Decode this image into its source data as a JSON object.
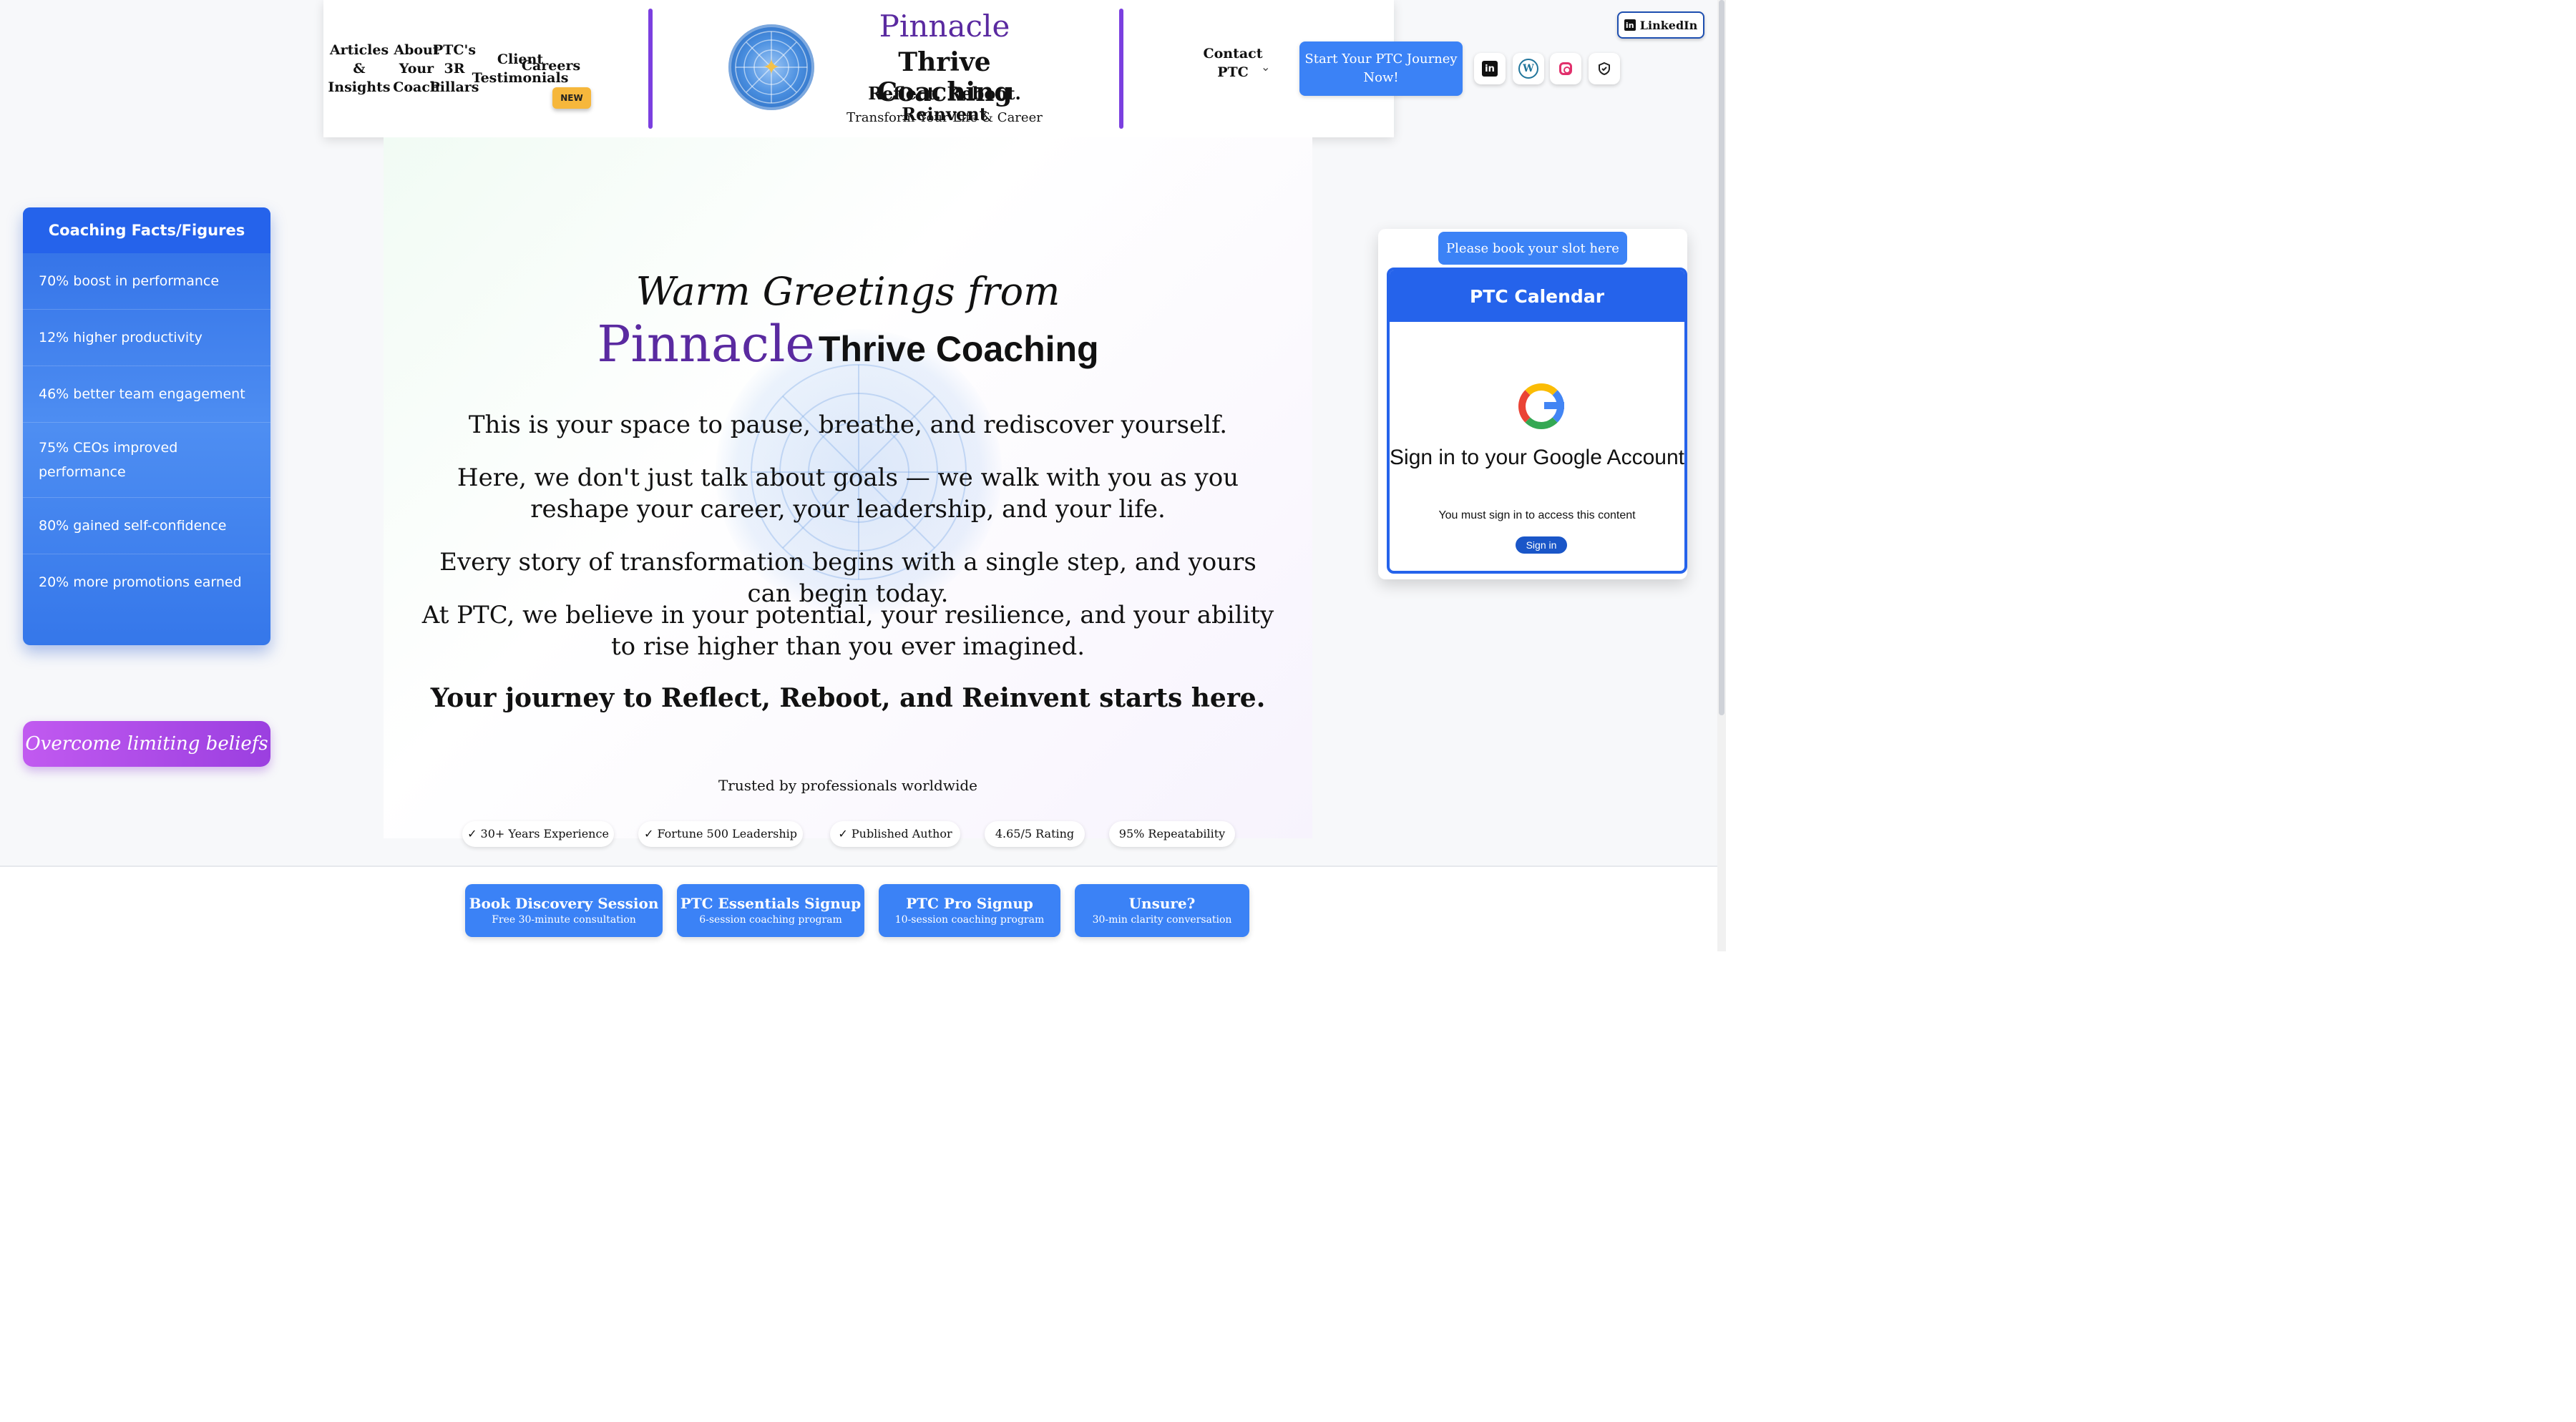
{
  "nav": {
    "about": "About Your Coach",
    "testimonials": "Client Testimonials",
    "articles": "Articles & Insights",
    "pillars": "PTC's 3R Pillars",
    "careers": "Careers",
    "new_badge": "NEW",
    "contact": "Contact PTC",
    "cta": "Start Your PTC Journey Now!"
  },
  "brand": {
    "name": "Pinnacle",
    "title": "Thrive Coaching",
    "tagline": "Reflect. Reboot. Reinvent",
    "subtitle": "Transform Your Life & Career"
  },
  "social": {
    "linkedin_badge": "LinkedIn",
    "icons": [
      "linkedin-icon",
      "wordpress-icon",
      "instagram-icon",
      "shield-icon"
    ]
  },
  "facts": {
    "title": "Coaching Facts/Figures",
    "items": [
      "70% boost in performance",
      "12% higher productivity",
      "46% better team engagement",
      "75% CEOs improved performance",
      "80% gained self-confidence",
      "20% more promotions earned"
    ],
    "pill": "Overcome limiting beliefs"
  },
  "hero": {
    "greeting": "Warm Greetings from",
    "brand": "Pinnacle",
    "brand_rest": "Thrive Coaching",
    "p1": "This is your space to pause, breathe, and rediscover yourself.",
    "p2": "Here, we don't just talk about goals — we walk with you as you reshape your career, your leadership, and your life.",
    "p3": "Every story of transformation begins with a single step, and yours can begin today.",
    "p4": "At PTC, we believe in your potential, your resilience, and your ability to rise higher than you ever imagined.",
    "p5": "Your journey to Reflect, Reboot, and Reinvent starts here.",
    "trusted": "Trusted by professionals worldwide",
    "chips": [
      "✓ 30+ Years Experience",
      "✓ Fortune 500 Leadership",
      "✓ Published Author",
      "4.65/5 Rating",
      "95% Repeatability"
    ]
  },
  "calendar": {
    "book": "Please book your slot here",
    "title": "PTC Calendar",
    "signin_title": "Sign in to your Google Account",
    "note": "You must sign in to access this content",
    "signin_btn": "Sign in"
  },
  "bottom": {
    "buttons": [
      {
        "label": "Book Discovery Session",
        "sub": "Free 30-minute consultation"
      },
      {
        "label": "PTC Essentials Signup",
        "sub": "6-session coaching program"
      },
      {
        "label": "PTC Pro Signup",
        "sub": "10-session coaching program"
      },
      {
        "label": "Unsure?",
        "sub": "30-min clarity conversation"
      }
    ]
  },
  "colors": {
    "primary": "#3b82f6",
    "brand_purple": "#5a2aa0",
    "divider": "#7b3fe0",
    "badge": "#f6b73c"
  }
}
